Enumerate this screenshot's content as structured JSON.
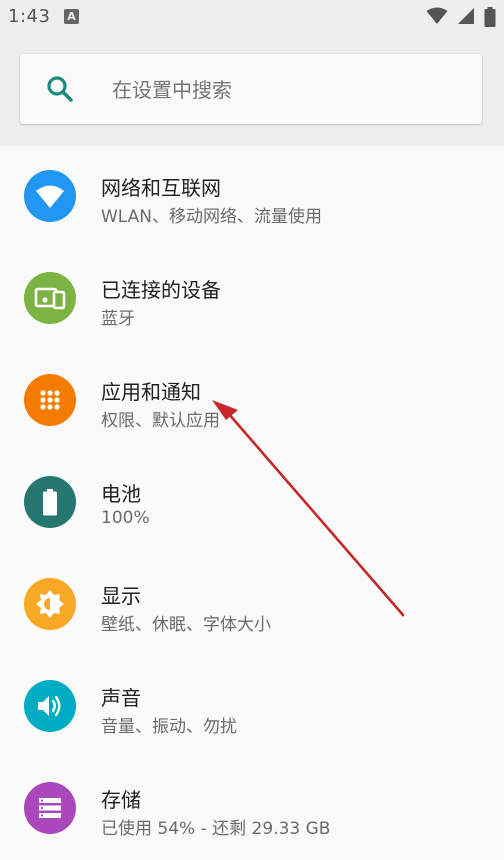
{
  "status_bar": {
    "time": "1:43",
    "notification_icon": "A"
  },
  "search": {
    "placeholder": "在设置中搜索"
  },
  "settings": [
    {
      "title": "网络和互联网",
      "subtitle": "WLAN、移动网络、流量使用",
      "icon": "wifi-icon",
      "color": "#2196f3"
    },
    {
      "title": "已连接的设备",
      "subtitle": "蓝牙",
      "icon": "devices-icon",
      "color": "#7cb342"
    },
    {
      "title": "应用和通知",
      "subtitle": "权限、默认应用",
      "icon": "apps-icon",
      "color": "#f57c00"
    },
    {
      "title": "电池",
      "subtitle": "100%",
      "icon": "battery-icon",
      "color": "#26776f"
    },
    {
      "title": "显示",
      "subtitle": "壁纸、休眠、字体大小",
      "icon": "brightness-icon",
      "color": "#f9a825"
    },
    {
      "title": "声音",
      "subtitle": "音量、振动、勿扰",
      "icon": "volume-icon",
      "color": "#00acc1"
    },
    {
      "title": "存储",
      "subtitle": "已使用 54% - 还剩 29.33 GB",
      "icon": "storage-icon",
      "color": "#ab47bc"
    }
  ],
  "annotation_color": "#c62828"
}
